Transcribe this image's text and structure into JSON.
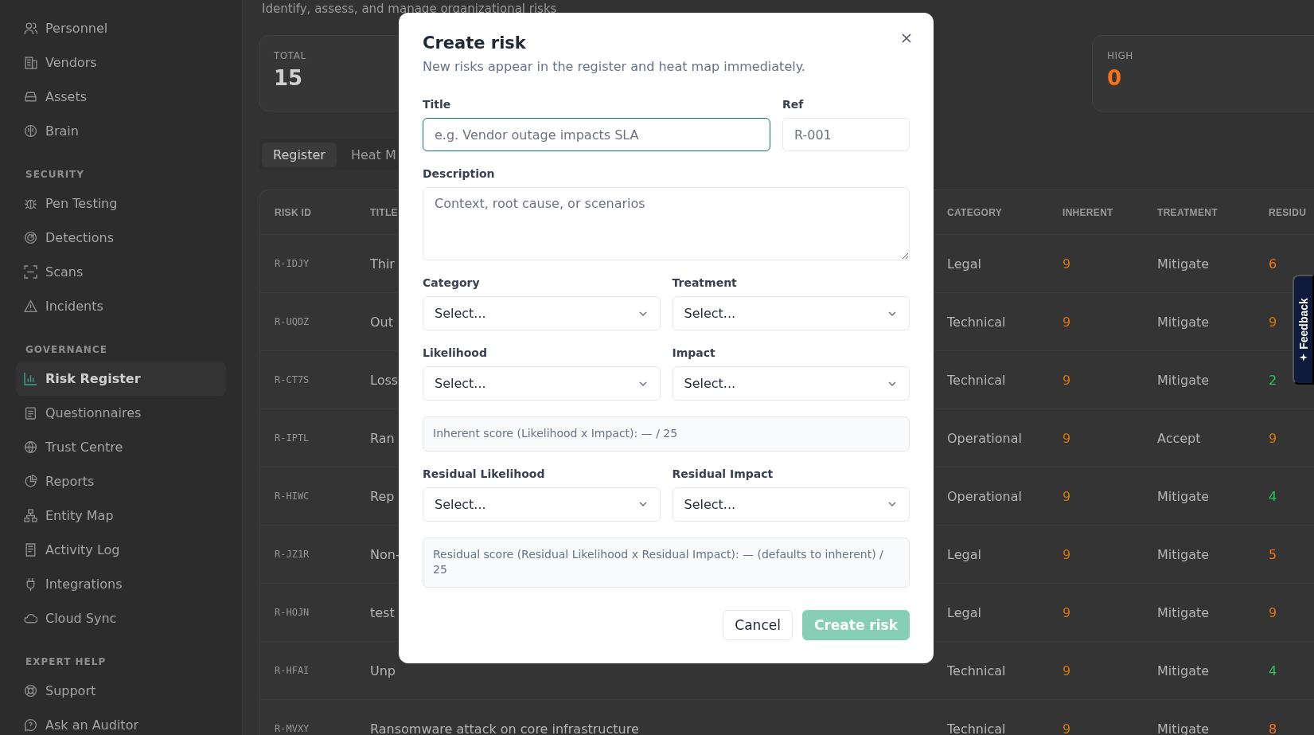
{
  "sidebar": {
    "groups": [
      {
        "items": [
          {
            "label": "Personnel",
            "selected": false
          },
          {
            "label": "Vendors",
            "selected": false
          },
          {
            "label": "Assets",
            "selected": false
          },
          {
            "label": "Brain",
            "selected": false
          }
        ]
      },
      {
        "heading": "SECURITY",
        "items": [
          {
            "label": "Pen Testing",
            "selected": false
          },
          {
            "label": "Detections",
            "selected": false
          },
          {
            "label": "Scans",
            "selected": false
          },
          {
            "label": "Incidents",
            "selected": false
          }
        ]
      },
      {
        "heading": "GOVERNANCE",
        "items": [
          {
            "label": "Risk Register",
            "selected": true
          },
          {
            "label": "Questionnaires",
            "selected": false
          },
          {
            "label": "Trust Centre",
            "selected": false
          },
          {
            "label": "Reports",
            "selected": false
          },
          {
            "label": "Entity Map",
            "selected": false
          },
          {
            "label": "Activity Log",
            "selected": false
          },
          {
            "label": "Integrations",
            "selected": false
          },
          {
            "label": "Cloud Sync",
            "selected": false
          }
        ]
      },
      {
        "heading": "EXPERT HELP",
        "items": [
          {
            "label": "Support",
            "selected": false
          },
          {
            "label": "Ask an Auditor",
            "selected": false
          }
        ]
      }
    ]
  },
  "header": {
    "subtitle": "Identify, assess, and manage organizational risks"
  },
  "stats": [
    {
      "label": "TOTAL",
      "value": "15",
      "kind": "neutral"
    },
    {
      "label": "HIGH",
      "value": "0",
      "kind": "high"
    }
  ],
  "tabs": [
    {
      "label": "Register",
      "selected": true
    },
    {
      "label": "Heat M",
      "selected": false
    }
  ],
  "table": {
    "columns": [
      "RISK ID",
      "TITLE",
      "CATEGORY",
      "INHERENT",
      "TREATMENT",
      "RESIDU"
    ],
    "rows": [
      {
        "id": "R-IDJY",
        "title": "Thir",
        "category": "Legal",
        "inherent": {
          "text": "9",
          "color": "#d97706"
        },
        "treatment": "Mitigate",
        "residual": {
          "text": "6",
          "color": "#f97316"
        }
      },
      {
        "id": "R-UQDZ",
        "title": "Out",
        "category": "Technical",
        "inherent": {
          "text": "9",
          "color": "#d97706"
        },
        "treatment": "Mitigate",
        "residual": {
          "text": "9",
          "color": "#d97706"
        }
      },
      {
        "id": "R-CT7S",
        "title": "Loss",
        "category": "Technical",
        "inherent": {
          "text": "9",
          "color": "#d97706"
        },
        "treatment": "Mitigate",
        "residual": {
          "text": "2",
          "color": "#22c55e"
        }
      },
      {
        "id": "R-IPTL",
        "title": "Ran",
        "category": "Operational",
        "inherent": {
          "text": "9",
          "color": "#d97706"
        },
        "treatment": "Accept",
        "residual": {
          "text": "9",
          "color": "#d97706"
        }
      },
      {
        "id": "R-HIWC",
        "title": "Rep",
        "category": "Operational",
        "inherent": {
          "text": "9",
          "color": "#d97706"
        },
        "treatment": "Mitigate",
        "residual": {
          "text": "4",
          "color": "#22c55e"
        }
      },
      {
        "id": "R-JZ1R",
        "title": "Non-",
        "category": "Legal",
        "inherent": {
          "text": "9",
          "color": "#d97706"
        },
        "treatment": "Mitigate",
        "residual": {
          "text": "5",
          "color": "#f97316"
        }
      },
      {
        "id": "R-HOJN",
        "title": "test",
        "category": "Legal",
        "inherent": {
          "text": "9",
          "color": "#d97706"
        },
        "treatment": "Mitigate",
        "residual": {
          "text": "9",
          "color": "#d97706"
        }
      },
      {
        "id": "R-HFAI",
        "title": "Unp",
        "category": "Technical",
        "inherent": {
          "text": "9",
          "color": "#d97706"
        },
        "treatment": "Mitigate",
        "residual": {
          "text": "4",
          "color": "#22c55e"
        }
      },
      {
        "id": "R-MVXY",
        "title": "Ransomware attack on core infrastructure",
        "category": "Technical",
        "inherent": {
          "text": "9",
          "color": "#d97706"
        },
        "treatment": "Mitigate",
        "residual": {
          "text": "8",
          "color": "#f97316"
        }
      }
    ]
  },
  "feedback": {
    "label": "Feedback"
  },
  "dialog": {
    "title": "Create risk",
    "subtitle": "New risks appear in the register and heat map immediately.",
    "rows": [
      {
        "kind": "fields",
        "fields": [
          {
            "kind": "text",
            "label": "Title",
            "placeholder": "e.g. Vendor outage impacts SLA",
            "focused": true
          },
          {
            "kind": "text",
            "label": "Ref",
            "placeholder": "R-001",
            "focused": false
          }
        ]
      },
      {
        "kind": "fields",
        "fields": [
          {
            "kind": "textarea",
            "label": "Description",
            "placeholder": "Context, root cause, or scenarios",
            "focused": false
          }
        ]
      },
      {
        "kind": "fields",
        "fields": [
          {
            "kind": "select",
            "label": "Category",
            "value": "Select..."
          },
          {
            "kind": "select",
            "label": "Treatment",
            "value": "Select..."
          }
        ]
      },
      {
        "kind": "fields",
        "fields": [
          {
            "kind": "select",
            "label": "Likelihood",
            "value": "Select..."
          },
          {
            "kind": "select",
            "label": "Impact",
            "value": "Select..."
          }
        ]
      },
      {
        "kind": "note",
        "text": "Inherent score (Likelihood x Impact): — / 25"
      },
      {
        "kind": "fields",
        "fields": [
          {
            "kind": "select",
            "label": "Residual Likelihood",
            "value": "Select..."
          },
          {
            "kind": "select",
            "label": "Residual Impact",
            "value": "Select..."
          }
        ]
      },
      {
        "kind": "note",
        "text": "Residual score (Residual Likelihood x Residual Impact): — (defaults to inherent) / 25"
      }
    ],
    "buttons": [
      {
        "label": "Cancel",
        "kind": "secondary",
        "disabled": false
      },
      {
        "label": "Create risk",
        "kind": "primary",
        "disabled": true
      }
    ]
  }
}
